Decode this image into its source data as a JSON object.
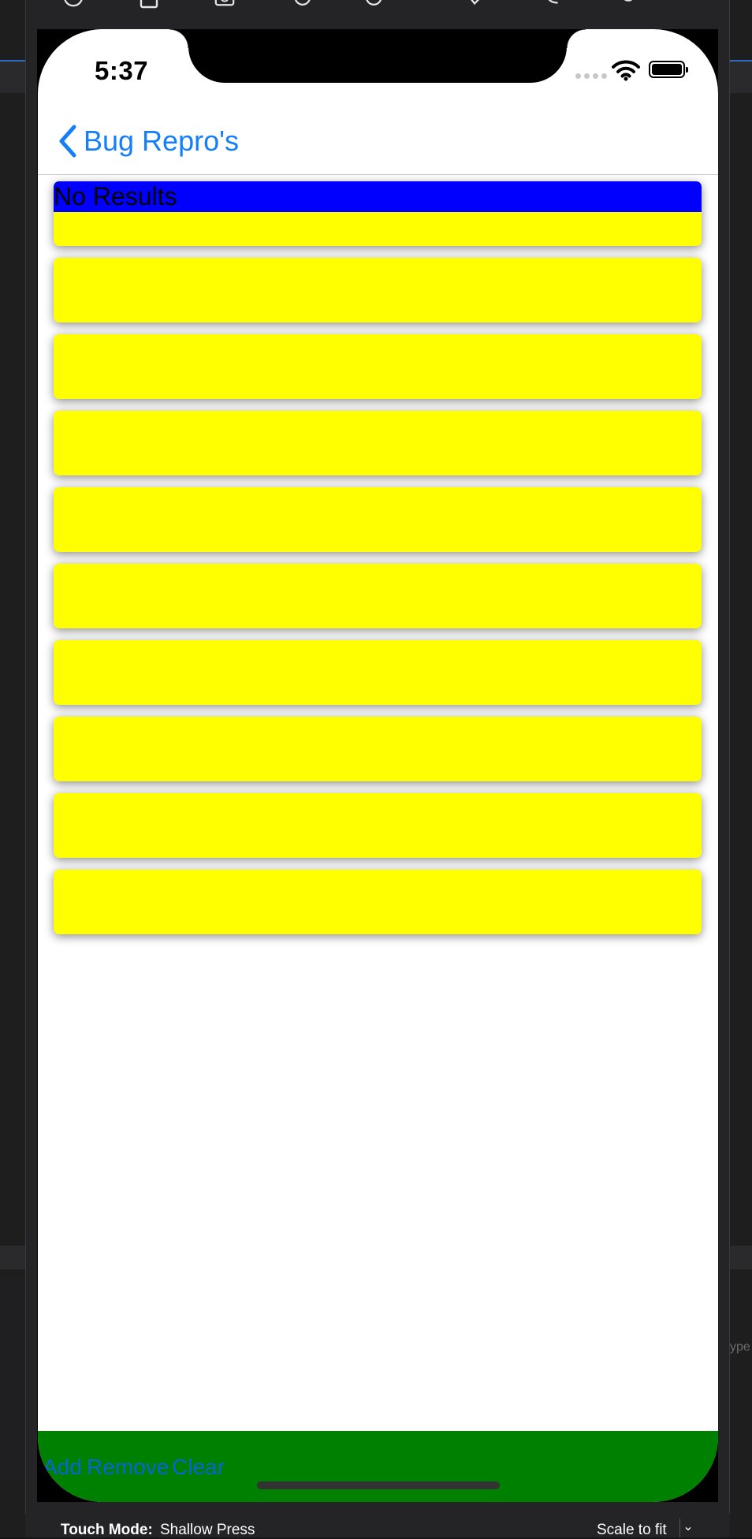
{
  "status_bar": {
    "time": "5:37"
  },
  "nav": {
    "back_label": "Bug Repro's"
  },
  "list": {
    "header_text": "No Results",
    "card_count": 10
  },
  "bottom_bar": {
    "add_label": "Add",
    "remove_label": "Remove",
    "clear_label": "Clear"
  },
  "footer": {
    "touch_mode_label": "Touch Mode:",
    "touch_mode_value": "Shallow Press",
    "scale_label": "Scale to fit"
  },
  "side_text": {
    "right_ghost": "ype"
  },
  "colors": {
    "card": "#ffff00",
    "header": "#0000ff",
    "bottom_bar": "#008000",
    "link": "#147efb"
  },
  "toolbar_icons": [
    "home-icon",
    "lock-icon",
    "screenshot-icon",
    "rotate-left-icon",
    "rotate-right-icon",
    "shake-icon",
    "phone-icon",
    "gear-icon",
    "more-icon"
  ]
}
